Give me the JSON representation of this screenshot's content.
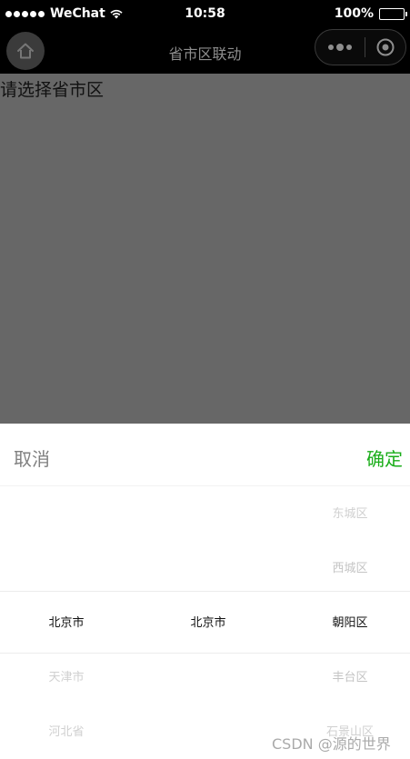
{
  "status_bar": {
    "carrier": "WeChat",
    "time": "10:58",
    "battery": "100%"
  },
  "nav": {
    "title": "省市区联动"
  },
  "page": {
    "prompt": "请选择省市区"
  },
  "picker": {
    "cancel_label": "取消",
    "confirm_label": "确定",
    "province": [
      "北京市",
      "天津市",
      "河北省"
    ],
    "city": [
      "北京市"
    ],
    "district": [
      "东城区",
      "西城区",
      "朝阳区",
      "丰台区",
      "石景山区"
    ],
    "selected": {
      "province": "北京市",
      "city": "北京市",
      "district": "朝阳区"
    }
  },
  "watermark": "CSDN @源的世界",
  "colors": {
    "confirm": "#1aad19",
    "cancel": "#808080",
    "overlay": "#676767"
  }
}
